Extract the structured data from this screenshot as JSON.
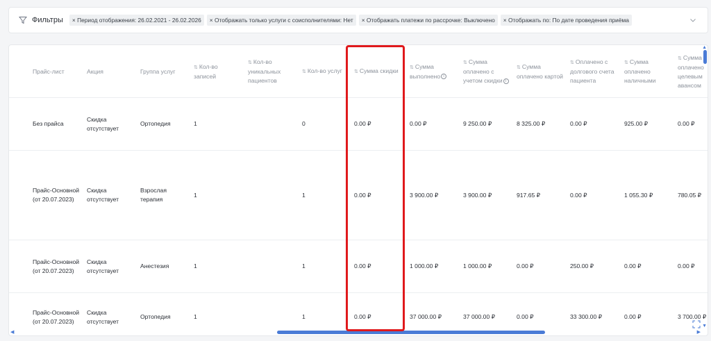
{
  "filters": {
    "label": "Фильтры",
    "chips": [
      "× Период отображения: 26.02.2021 - 26.02.2026",
      "× Отображать только услуги с соисполнителями: Нет",
      "× Отображать платежи по рассрочке: Выключено",
      "× Отображать по: По дате проведения приёма"
    ]
  },
  "table": {
    "sort_glyph": "⇅",
    "headers": [
      {
        "lines": [
          "Прайс-лист"
        ],
        "sortable": false
      },
      {
        "lines": [
          "Акция"
        ],
        "sortable": false
      },
      {
        "lines": [
          "Группа услуг"
        ],
        "sortable": false
      },
      {
        "lines": [
          "Кол-во",
          "записей"
        ],
        "sortable": true
      },
      {
        "lines": [
          "Кол-во",
          "уникальных",
          "пациентов"
        ],
        "sortable": true
      },
      {
        "lines": [
          "Кол-во услуг"
        ],
        "sortable": true
      },
      {
        "lines": [
          "Сумма скидки"
        ],
        "sortable": true
      },
      {
        "lines": [
          "Сумма",
          "выполнено"
        ],
        "sortable": true,
        "info": true
      },
      {
        "lines": [
          "Сумма",
          "оплачено с",
          "учетом скидки"
        ],
        "sortable": true,
        "info": true
      },
      {
        "lines": [
          "Сумма",
          "оплачено картой"
        ],
        "sortable": true
      },
      {
        "lines": [
          "Оплачено с",
          "долгового счета",
          "пациента"
        ],
        "sortable": true
      },
      {
        "lines": [
          "Сумма",
          "оплачено",
          "наличными"
        ],
        "sortable": true
      },
      {
        "lines": [
          "Сумма",
          "оплачено",
          "целевым",
          "авансом"
        ],
        "sortable": true
      }
    ],
    "rows": [
      {
        "cells": [
          [
            "Без прайса"
          ],
          [
            "Скидка",
            "отсутствует"
          ],
          [
            "Ортопедия"
          ],
          [
            "1"
          ],
          [
            ""
          ],
          [
            "0"
          ],
          [
            "0.00 ₽"
          ],
          [
            "0.00 ₽"
          ],
          [
            "9 250.00 ₽"
          ],
          [
            "8 325.00 ₽"
          ],
          [
            "0.00 ₽"
          ],
          [
            "925.00 ₽"
          ],
          [
            "0.00 ₽"
          ]
        ]
      },
      {
        "cells": [
          [
            "Прайс-Основной",
            "(от 20.07.2023)"
          ],
          [
            "Скидка",
            "отсутствует"
          ],
          [
            "Взрослая",
            "терапия"
          ],
          [
            "1"
          ],
          [
            ""
          ],
          [
            "1"
          ],
          [
            "0.00 ₽"
          ],
          [
            "3 900.00 ₽"
          ],
          [
            "3 900.00 ₽"
          ],
          [
            "917.65 ₽"
          ],
          [
            "0.00 ₽"
          ],
          [
            "1 055.30 ₽"
          ],
          [
            "780.05 ₽"
          ]
        ]
      },
      {
        "cells": [
          [
            "Прайс-Основной",
            "(от 20.07.2023)"
          ],
          [
            "Скидка",
            "отсутствует"
          ],
          [
            "Анестезия"
          ],
          [
            "1"
          ],
          [
            ""
          ],
          [
            "1"
          ],
          [
            "0.00 ₽"
          ],
          [
            "1 000.00 ₽"
          ],
          [
            "1 000.00 ₽"
          ],
          [
            "0.00 ₽"
          ],
          [
            "250.00 ₽"
          ],
          [
            "0.00 ₽"
          ],
          [
            "0.00 ₽"
          ]
        ]
      },
      {
        "cells": [
          [
            "Прайс-Основной",
            "(от 20.07.2023)"
          ],
          [
            "Скидка",
            "отсутствует"
          ],
          [
            "Ортопедия"
          ],
          [
            "1"
          ],
          [
            ""
          ],
          [
            "1"
          ],
          [
            "0.00 ₽"
          ],
          [
            "37 000.00 ₽"
          ],
          [
            "37 000.00 ₽"
          ],
          [
            "0.00 ₽"
          ],
          [
            "33 300.00 ₽"
          ],
          [
            "0.00 ₽"
          ],
          [
            "3 700.00 ₽"
          ]
        ]
      }
    ]
  },
  "colors": {
    "highlight": "#e0191c",
    "scroll": "#4a7bd6"
  }
}
